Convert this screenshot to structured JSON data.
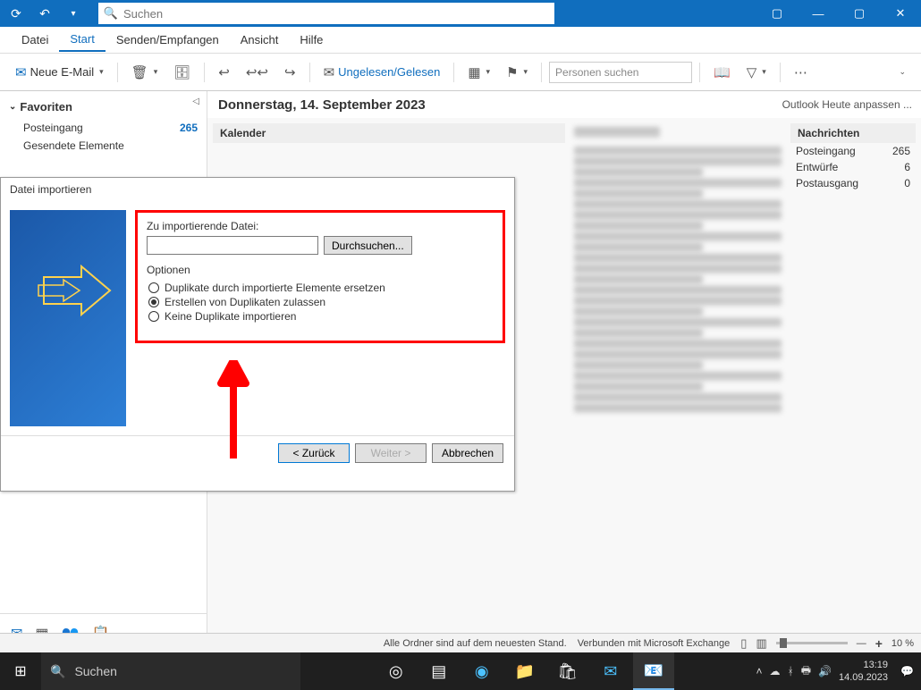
{
  "titlebar": {
    "search_placeholder": "Suchen"
  },
  "menu": {
    "datei": "Datei",
    "start": "Start",
    "senden": "Senden/Empfangen",
    "ansicht": "Ansicht",
    "hilfe": "Hilfe"
  },
  "ribbon": {
    "new_mail": "Neue E-Mail",
    "unread_read": "Ungelesen/Gelesen",
    "search_people_placeholder": "Personen suchen"
  },
  "sidebar": {
    "favorites": "Favoriten",
    "posteingang": "Posteingang",
    "posteingang_count": "265",
    "sent": "Gesendete Elemente"
  },
  "content": {
    "date": "Donnerstag, 14. September 2023",
    "customize": "Outlook Heute anpassen ...",
    "kalender": "Kalender",
    "nachrichten": "Nachrichten",
    "msgs": {
      "posteingang": "Posteingang",
      "posteingang_n": "265",
      "entwuerfe": "Entwürfe",
      "entwuerfe_n": "6",
      "postausgang": "Postausgang",
      "postausgang_n": "0"
    }
  },
  "dialog": {
    "title": "Datei importieren",
    "file_label": "Zu importierende Datei:",
    "browse": "Durchsuchen...",
    "options": "Optionen",
    "opt1": "Duplikate durch importierte Elemente ersetzen",
    "opt2": "Erstellen von Duplikaten zulassen",
    "opt3": "Keine Duplikate importieren",
    "back": "< Zurück",
    "next": "Weiter >",
    "cancel": "Abbrechen"
  },
  "status": {
    "all_folders": "Alle Ordner sind auf dem neuesten Stand.",
    "connected": "Verbunden mit Microsoft Exchange",
    "zoom": "10 %"
  },
  "taskbar": {
    "search": "Suchen",
    "time": "13:19",
    "date": "14.09.2023"
  }
}
